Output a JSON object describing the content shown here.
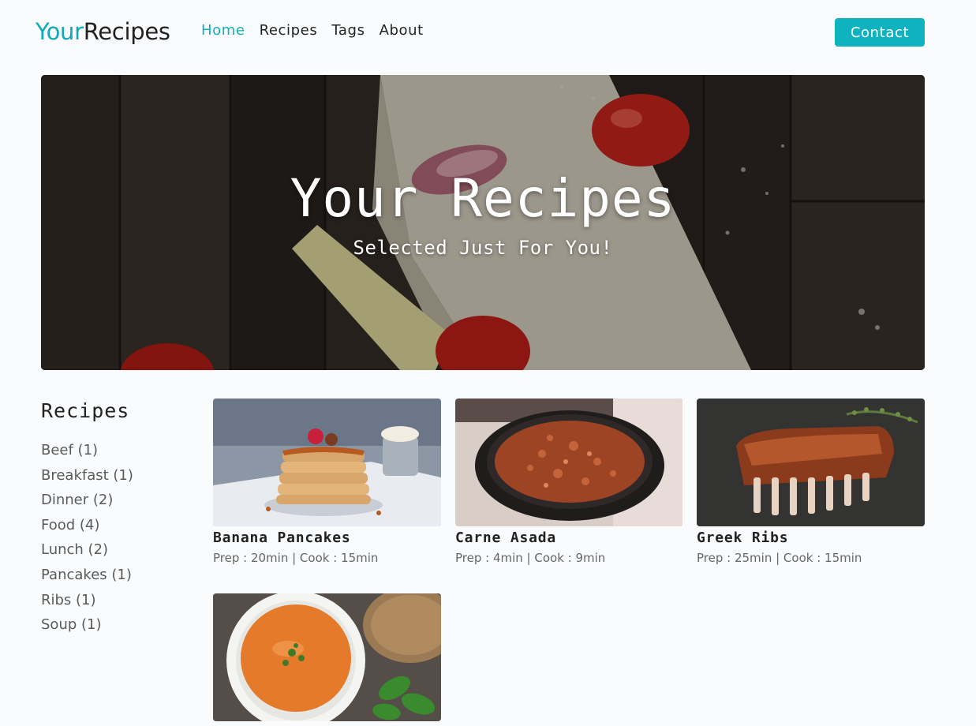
{
  "nav": {
    "brand_accent": "Your",
    "brand_rest": "Recipes",
    "links": [
      "Home",
      "Recipes",
      "Tags",
      "About"
    ],
    "active": "Home",
    "contact_label": "Contact"
  },
  "hero": {
    "title": "Your Recipes",
    "subtitle": "Selected Just For You!"
  },
  "sidebar": {
    "heading": "Recipes",
    "tags": [
      "Beef (1)",
      "Breakfast (1)",
      "Dinner (2)",
      "Food (4)",
      "Lunch (2)",
      "Pancakes (1)",
      "Ribs (1)",
      "Soup (1)"
    ]
  },
  "recipes": [
    {
      "title": "Banana Pancakes",
      "meta": "Prep : 20min | Cook : 15min",
      "image": "pancakes-photo"
    },
    {
      "title": "Carne Asada",
      "meta": "Prep : 4min | Cook : 9min",
      "image": "carne-asada-photo"
    },
    {
      "title": "Greek Ribs",
      "meta": "Prep : 25min | Cook : 15min",
      "image": "ribs-photo"
    },
    {
      "title": "",
      "meta": "",
      "image": "soup-photo"
    }
  ],
  "colors": {
    "accent": "#0fb3c0",
    "background": "#f9fbfd",
    "text": "#222222",
    "muted": "#666666"
  }
}
